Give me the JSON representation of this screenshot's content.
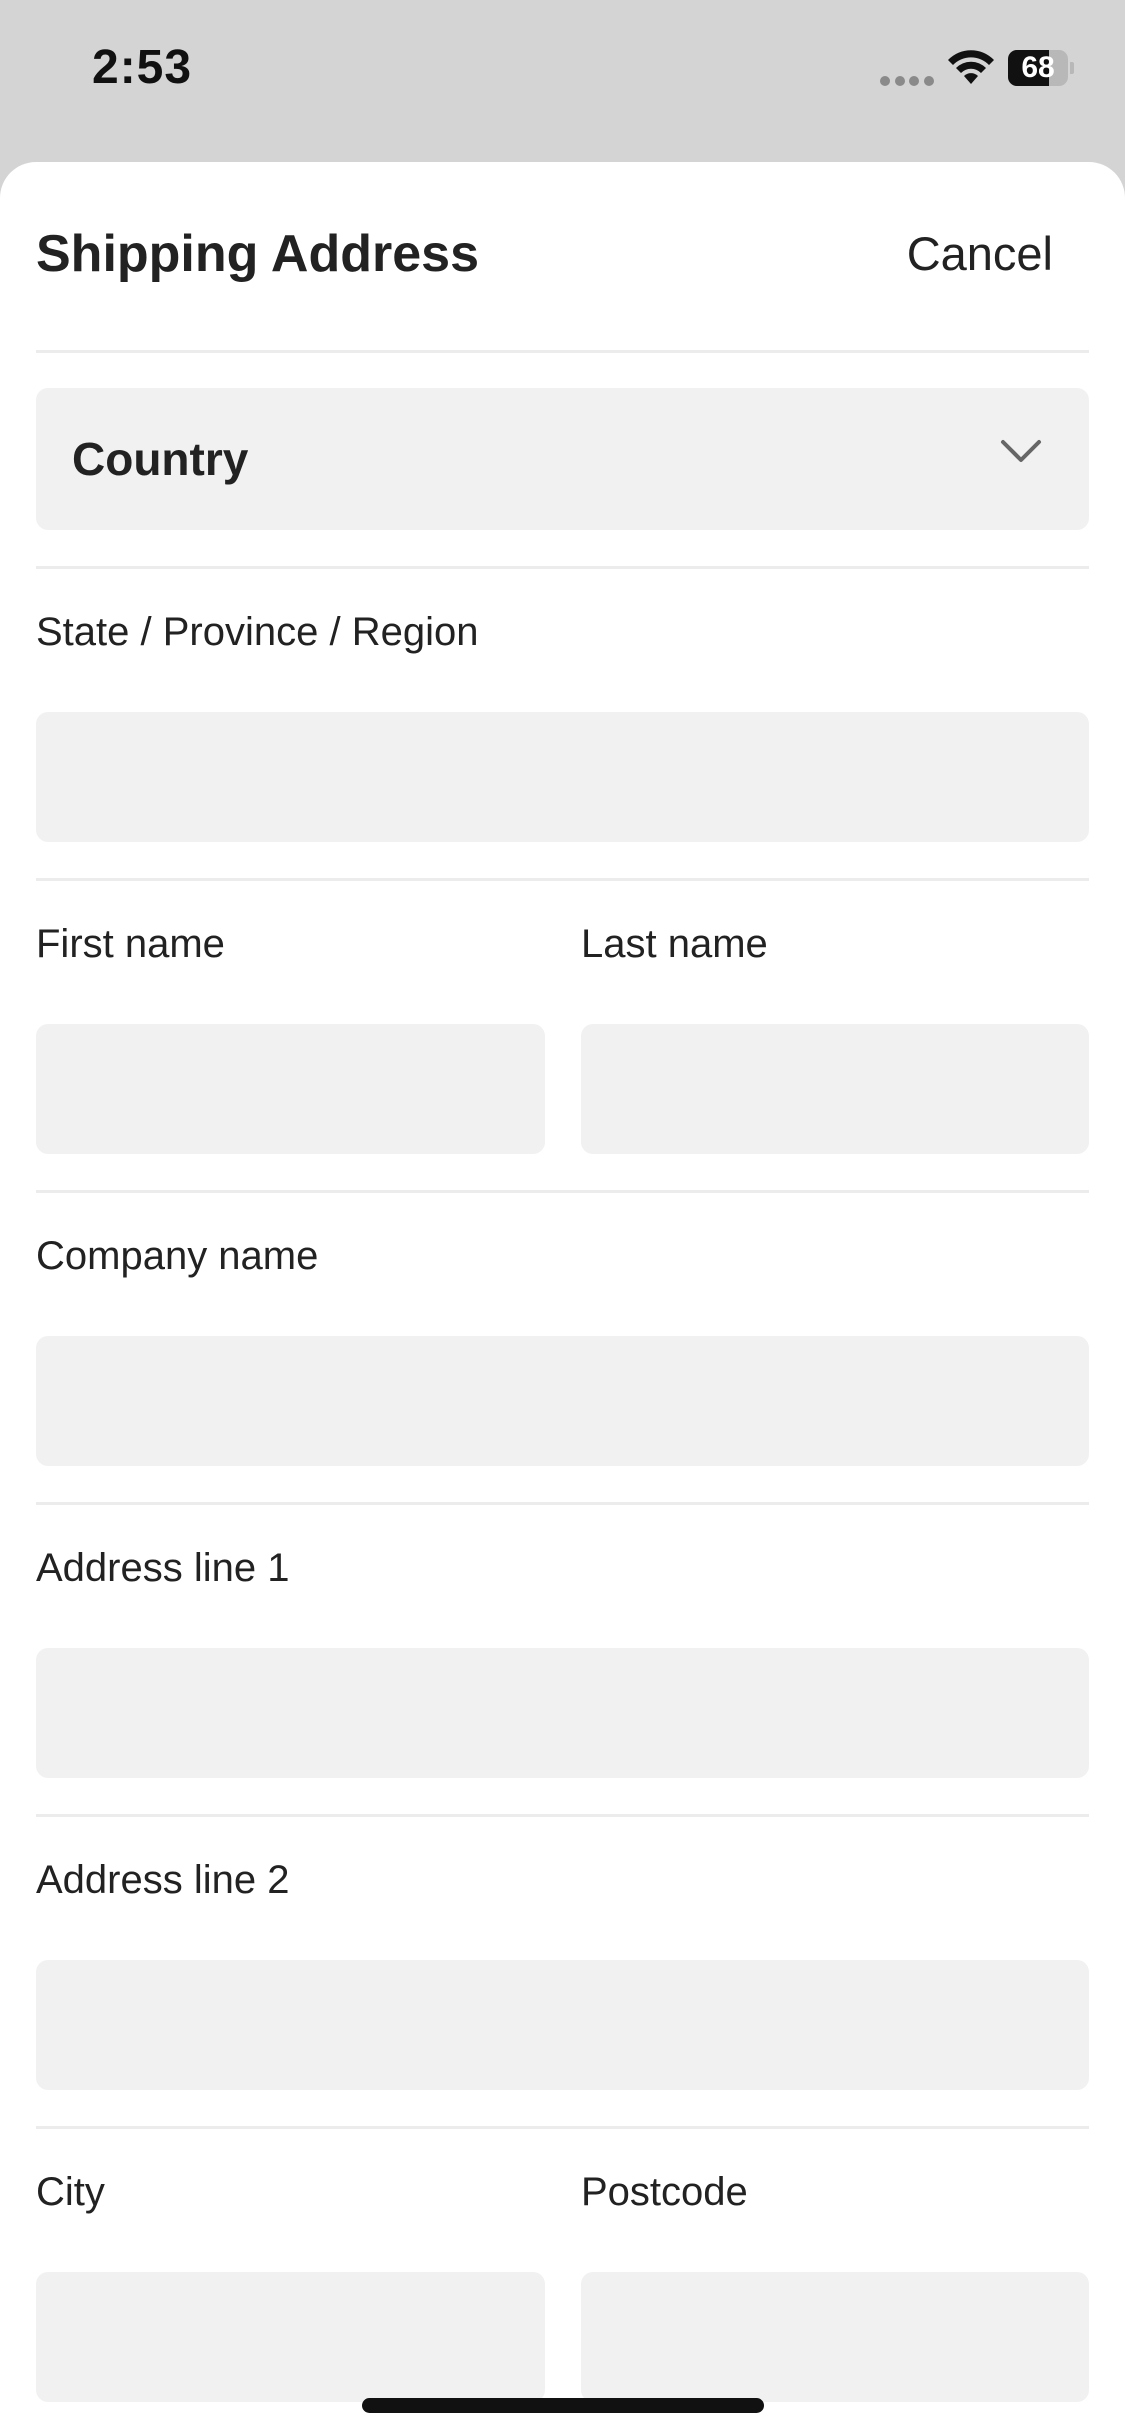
{
  "status_bar": {
    "time": "2:53",
    "battery_percent": "68",
    "battery_level": 0.68,
    "icons": [
      "signal-dots-icon",
      "wifi-icon",
      "battery-icon"
    ]
  },
  "sheet": {
    "title": "Shipping Address",
    "cancel_label": "Cancel"
  },
  "form": {
    "country": {
      "label": "Country",
      "icon": "chevron-down-icon"
    },
    "state": {
      "label": "State / Province / Region",
      "value": ""
    },
    "first_name": {
      "label": "First name",
      "value": ""
    },
    "last_name": {
      "label": "Last name",
      "value": ""
    },
    "company": {
      "label": "Company name",
      "value": ""
    },
    "address1": {
      "label": "Address line 1",
      "value": ""
    },
    "address2": {
      "label": "Address line 2",
      "value": ""
    },
    "city": {
      "label": "City",
      "value": ""
    },
    "postcode": {
      "label": "Postcode",
      "value": ""
    }
  },
  "colors": {
    "sheet_background": "#ffffff",
    "backdrop": "#d4d4d4",
    "field_background": "#f1f1f1",
    "divider": "#ececec",
    "text": "#222222"
  }
}
